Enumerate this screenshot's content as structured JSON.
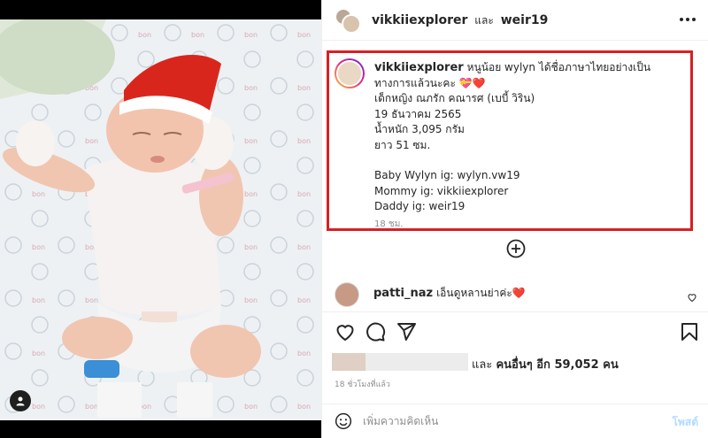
{
  "post": {
    "header": {
      "user1": "vikkiiexplorer",
      "and_text": "และ",
      "user2": "weir19"
    },
    "caption": {
      "username": "vikkiiexplorer",
      "line1": "หนูน้อย wylyn ได้ชื่อภาษาไทยอย่างเป็นทางการแล้วนะคะ 💝❤️",
      "line2": "เด็กหญิง ณภรัก คณารศ (เบบี้ วิริน)",
      "line3": "19 ธันวาคม 2565",
      "line4": "น้ำหนัก 3,095 กรัม",
      "line5": "ยาว 51 ซม.",
      "line6": "Baby Wylyn ig: wylyn.vw19",
      "line7": "Mommy ig: vikkiiexplorer",
      "line8": "Daddy ig: weir19",
      "time": "18 ชม."
    },
    "comment": {
      "username": "patti_naz",
      "text": "เอ็นดูหลานย่าค่ะ❤️"
    },
    "likes": {
      "prefix": "และ",
      "bold": "คนอื่นๆ อีก 59,052 คน"
    },
    "post_time": "18 ชั่วโมงที่แล้ว",
    "comment_input": {
      "placeholder": "เพิ่มความคิดเห็น",
      "post_label": "โพสต์"
    }
  },
  "colors": {
    "highlight_border": "#d62024",
    "heart": "#ed1c24",
    "post_button": "#b3dbff"
  },
  "icons": [
    "more-icon",
    "add-circle-icon",
    "heart-icon",
    "comment-icon",
    "share-icon",
    "bookmark-icon",
    "emoji-icon",
    "user-tag-icon"
  ]
}
